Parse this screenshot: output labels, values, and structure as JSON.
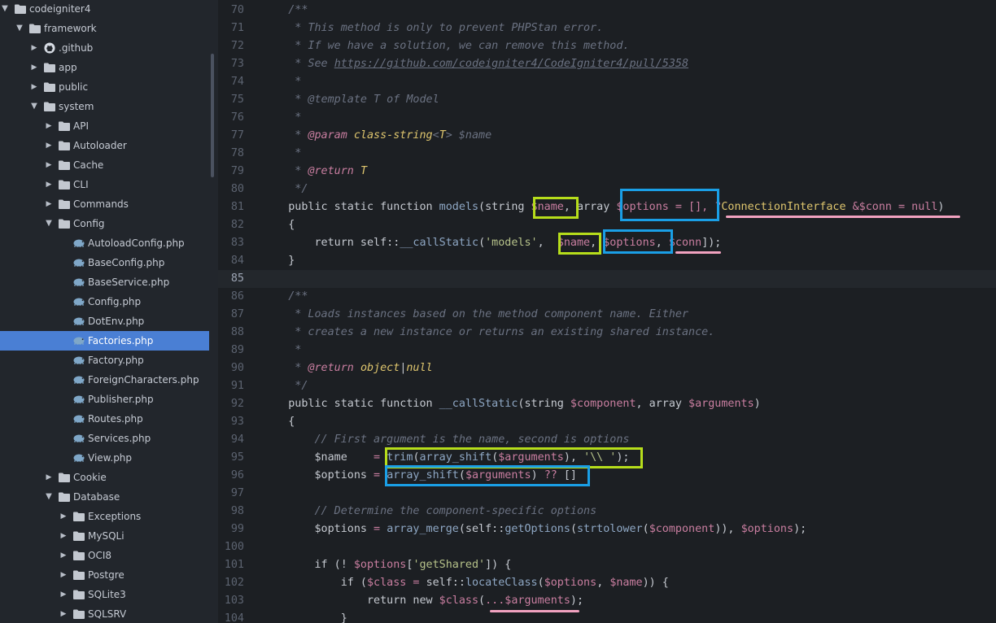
{
  "sidebar": {
    "items": [
      {
        "label": "codeigniter4",
        "type": "folder",
        "expanded": true,
        "depth": 0
      },
      {
        "label": "framework",
        "type": "folder",
        "expanded": true,
        "depth": 1
      },
      {
        "label": ".github",
        "type": "github",
        "expanded": false,
        "depth": 2
      },
      {
        "label": "app",
        "type": "folder",
        "expanded": false,
        "depth": 2
      },
      {
        "label": "public",
        "type": "folder",
        "expanded": false,
        "depth": 2
      },
      {
        "label": "system",
        "type": "folder",
        "expanded": true,
        "depth": 2
      },
      {
        "label": "API",
        "type": "folder",
        "expanded": false,
        "depth": 3
      },
      {
        "label": "Autoloader",
        "type": "folder",
        "expanded": false,
        "depth": 3
      },
      {
        "label": "Cache",
        "type": "folder",
        "expanded": false,
        "depth": 3
      },
      {
        "label": "CLI",
        "type": "folder",
        "expanded": false,
        "depth": 3
      },
      {
        "label": "Commands",
        "type": "folder",
        "expanded": false,
        "depth": 3
      },
      {
        "label": "Config",
        "type": "folder",
        "expanded": true,
        "depth": 3
      },
      {
        "label": "AutoloadConfig.php",
        "type": "php",
        "depth": 4
      },
      {
        "label": "BaseConfig.php",
        "type": "php",
        "depth": 4
      },
      {
        "label": "BaseService.php",
        "type": "php",
        "depth": 4
      },
      {
        "label": "Config.php",
        "type": "php",
        "depth": 4
      },
      {
        "label": "DotEnv.php",
        "type": "php",
        "depth": 4
      },
      {
        "label": "Factories.php",
        "type": "php",
        "depth": 4,
        "selected": true
      },
      {
        "label": "Factory.php",
        "type": "php",
        "depth": 4
      },
      {
        "label": "ForeignCharacters.php",
        "type": "php",
        "depth": 4
      },
      {
        "label": "Publisher.php",
        "type": "php",
        "depth": 4
      },
      {
        "label": "Routes.php",
        "type": "php",
        "depth": 4
      },
      {
        "label": "Services.php",
        "type": "php",
        "depth": 4
      },
      {
        "label": "View.php",
        "type": "php",
        "depth": 4
      },
      {
        "label": "Cookie",
        "type": "folder",
        "expanded": false,
        "depth": 3
      },
      {
        "label": "Database",
        "type": "folder",
        "expanded": true,
        "depth": 3
      },
      {
        "label": "Exceptions",
        "type": "folder",
        "expanded": false,
        "depth": 4
      },
      {
        "label": "MySQLi",
        "type": "folder",
        "expanded": false,
        "depth": 4
      },
      {
        "label": "OCI8",
        "type": "folder",
        "expanded": false,
        "depth": 4
      },
      {
        "label": "Postgre",
        "type": "folder",
        "expanded": false,
        "depth": 4
      },
      {
        "label": "SQLite3",
        "type": "folder",
        "expanded": false,
        "depth": 4
      },
      {
        "label": "SQLSRV",
        "type": "folder",
        "expanded": false,
        "depth": 4
      }
    ]
  },
  "editor": {
    "current_line": 85,
    "lines": [
      {
        "n": "70",
        "t": [
          [
            "    /**",
            "c"
          ]
        ]
      },
      {
        "n": "71",
        "t": [
          [
            "     * This method is only to prevent PHPStan error.",
            "c"
          ]
        ]
      },
      {
        "n": "72",
        "t": [
          [
            "     * If we have a solution, we can remove this method.",
            "c"
          ]
        ]
      },
      {
        "n": "73",
        "t": [
          [
            "     * See ",
            "c"
          ],
          [
            "https://github.com/codeigniter4/CodeIgniter4/pull/5358",
            "u"
          ]
        ]
      },
      {
        "n": "74",
        "t": [
          [
            "     *",
            "c"
          ]
        ]
      },
      {
        "n": "75",
        "t": [
          [
            "     * @template T of Model",
            "c"
          ]
        ]
      },
      {
        "n": "76",
        "t": [
          [
            "     *",
            "c"
          ]
        ]
      },
      {
        "n": "77",
        "t": [
          [
            "     * ",
            "c"
          ],
          [
            "@param",
            "tg"
          ],
          [
            " ",
            "c"
          ],
          [
            "class-string",
            "y"
          ],
          [
            "<",
            "c"
          ],
          [
            "T",
            "y"
          ],
          [
            "> $name",
            "c"
          ]
        ]
      },
      {
        "n": "78",
        "t": [
          [
            "     *",
            "c"
          ]
        ]
      },
      {
        "n": "79",
        "t": [
          [
            "     * ",
            "c"
          ],
          [
            "@return",
            "tg"
          ],
          [
            " ",
            "c"
          ],
          [
            "T",
            "y"
          ]
        ]
      },
      {
        "n": "80",
        "t": [
          [
            "     */",
            "c"
          ]
        ]
      },
      {
        "n": "81",
        "t": [
          [
            "    public static function ",
            "kw"
          ],
          [
            "models",
            "fn"
          ],
          [
            "(string ",
            "kw"
          ],
          [
            "$name",
            "v"
          ],
          [
            ", array ",
            "kw"
          ],
          [
            "$options",
            "v"
          ],
          [
            " = [], ",
            "o"
          ],
          [
            "?",
            "o"
          ],
          [
            "ConnectionInterface",
            "ty"
          ],
          [
            " &",
            "o"
          ],
          [
            "$conn",
            "v"
          ],
          [
            " = null",
            "o"
          ],
          [
            ")",
            "kw"
          ]
        ]
      },
      {
        "n": "82",
        "t": [
          [
            "    {",
            "kw"
          ]
        ]
      },
      {
        "n": "83",
        "t": [
          [
            "        return self::",
            "kw"
          ],
          [
            "__callStatic",
            "fn"
          ],
          [
            "(",
            "kw"
          ],
          [
            "'models'",
            "str"
          ],
          [
            ",  ",
            "kw"
          ],
          [
            "$name",
            "v"
          ],
          [
            ", ",
            "kw"
          ],
          [
            "$options",
            "v"
          ],
          [
            ", ",
            "kw"
          ],
          [
            "$conn",
            "v"
          ],
          [
            "]);",
            "kw"
          ]
        ]
      },
      {
        "n": "84",
        "t": [
          [
            "    }",
            "kw"
          ]
        ]
      },
      {
        "n": "85",
        "t": [
          [
            "",
            "kw"
          ]
        ]
      },
      {
        "n": "86",
        "t": [
          [
            "    /**",
            "c"
          ]
        ]
      },
      {
        "n": "87",
        "t": [
          [
            "     * Loads instances based on the method component name. Either",
            "c"
          ]
        ]
      },
      {
        "n": "88",
        "t": [
          [
            "     * creates a new instance or returns an existing shared instance.",
            "c"
          ]
        ]
      },
      {
        "n": "89",
        "t": [
          [
            "     *",
            "c"
          ]
        ]
      },
      {
        "n": "90",
        "t": [
          [
            "     * ",
            "c"
          ],
          [
            "@return",
            "tg"
          ],
          [
            " ",
            "c"
          ],
          [
            "object",
            "y"
          ],
          [
            "|",
            "kw"
          ],
          [
            "null",
            "y"
          ]
        ]
      },
      {
        "n": "91",
        "t": [
          [
            "     */",
            "c"
          ]
        ]
      },
      {
        "n": "92",
        "t": [
          [
            "    public static function ",
            "kw"
          ],
          [
            "__callStatic",
            "fn"
          ],
          [
            "(string ",
            "kw"
          ],
          [
            "$component",
            "v"
          ],
          [
            ", array ",
            "kw"
          ],
          [
            "$arguments",
            "v"
          ],
          [
            ")",
            "kw"
          ]
        ]
      },
      {
        "n": "93",
        "t": [
          [
            "    {",
            "kw"
          ]
        ]
      },
      {
        "n": "94",
        "t": [
          [
            "        // First argument is the name, second is options",
            "c"
          ]
        ]
      },
      {
        "n": "95",
        "t": [
          [
            "        $name",
            "kw"
          ],
          [
            "    = ",
            "o"
          ],
          [
            "trim",
            "fn"
          ],
          [
            "(",
            "kw"
          ],
          [
            "array_shift",
            "fn"
          ],
          [
            "(",
            "kw"
          ],
          [
            "$arguments",
            "v"
          ],
          [
            "), ",
            "kw"
          ],
          [
            "'\\\\ '",
            "str"
          ],
          [
            ");",
            "kw"
          ]
        ]
      },
      {
        "n": "96",
        "t": [
          [
            "        $options",
            "kw"
          ],
          [
            " = ",
            "o"
          ],
          [
            "array_shift",
            "fn"
          ],
          [
            "(",
            "kw"
          ],
          [
            "$arguments",
            "v"
          ],
          [
            ") ",
            "kw"
          ],
          [
            "??",
            "o"
          ],
          [
            " []",
            "kw"
          ]
        ]
      },
      {
        "n": "97",
        "t": [
          [
            "",
            "kw"
          ]
        ]
      },
      {
        "n": "98",
        "t": [
          [
            "        // Determine the component-specific options",
            "c"
          ]
        ]
      },
      {
        "n": "99",
        "t": [
          [
            "        $options",
            "kw"
          ],
          [
            " = ",
            "o"
          ],
          [
            "array_merge",
            "fn"
          ],
          [
            "(self::",
            "kw"
          ],
          [
            "getOptions",
            "fn"
          ],
          [
            "(",
            "kw"
          ],
          [
            "strtolower",
            "fn"
          ],
          [
            "(",
            "kw"
          ],
          [
            "$component",
            "v"
          ],
          [
            ")), ",
            "kw"
          ],
          [
            "$options",
            "v"
          ],
          [
            ");",
            "kw"
          ]
        ]
      },
      {
        "n": "100",
        "t": [
          [
            "",
            "kw"
          ]
        ]
      },
      {
        "n": "101",
        "t": [
          [
            "        if (! ",
            "kw"
          ],
          [
            "$options",
            "v"
          ],
          [
            "[",
            "kw"
          ],
          [
            "'getShared'",
            "str"
          ],
          [
            "]) {",
            "kw"
          ]
        ]
      },
      {
        "n": "102",
        "t": [
          [
            "            if (",
            "kw"
          ],
          [
            "$class",
            "v"
          ],
          [
            " = ",
            "o"
          ],
          [
            "self::",
            "kw"
          ],
          [
            "locateClass",
            "fn"
          ],
          [
            "(",
            "kw"
          ],
          [
            "$options",
            "v"
          ],
          [
            ", ",
            "kw"
          ],
          [
            "$name",
            "v"
          ],
          [
            ")) {",
            "kw"
          ]
        ]
      },
      {
        "n": "103",
        "t": [
          [
            "                return new ",
            "kw"
          ],
          [
            "$class",
            "v"
          ],
          [
            "(",
            "kw"
          ],
          [
            "...",
            "o"
          ],
          [
            "$arguments",
            "v"
          ],
          [
            ");",
            "kw"
          ]
        ]
      },
      {
        "n": "104",
        "t": [
          [
            "            }",
            "kw"
          ]
        ]
      }
    ]
  },
  "colors": {
    "highlight_green": "#b6dd1b",
    "highlight_blue": "#1a9fe6",
    "underline_pink": "#f2a2c0",
    "selection": "#4a7fd4"
  }
}
